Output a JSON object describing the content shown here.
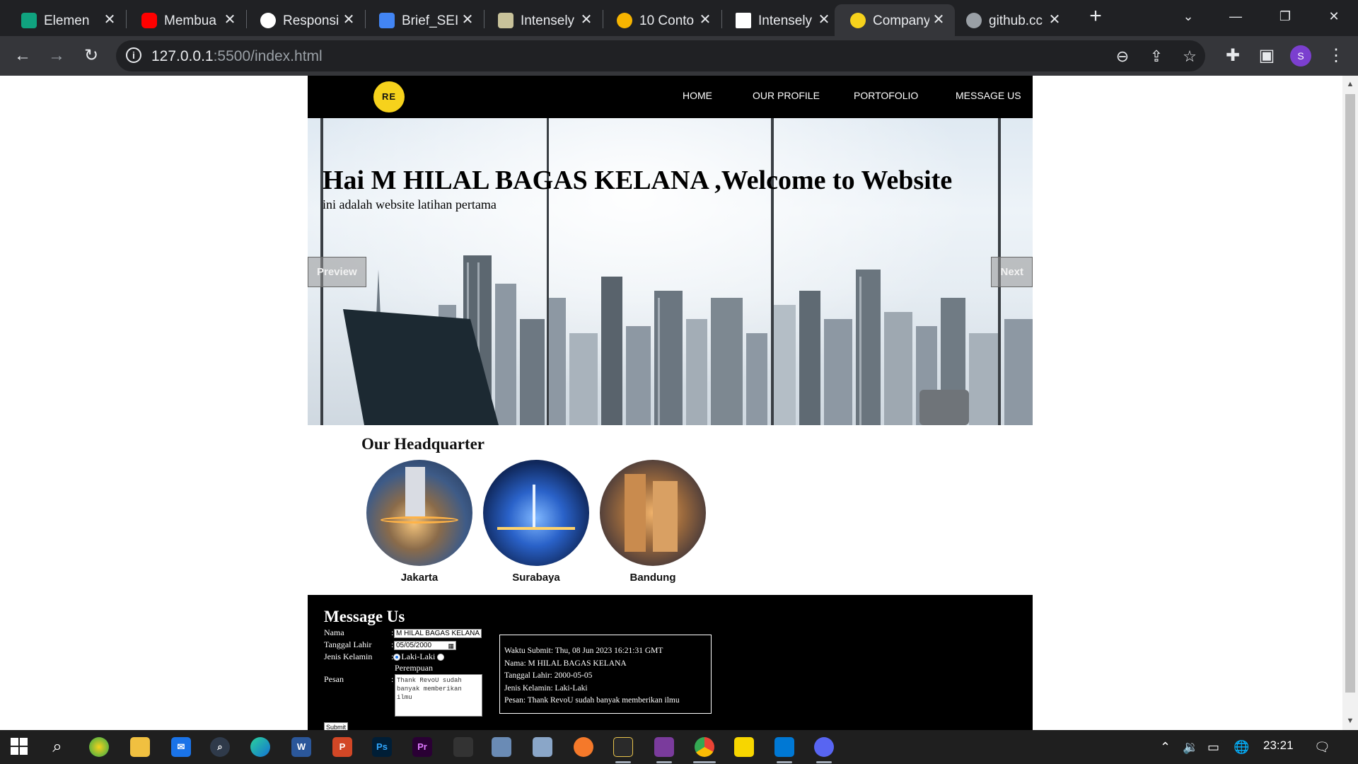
{
  "browser": {
    "tabs": [
      {
        "title": "Elemen",
        "icon": "chatgpt-icon",
        "color": "#10a37f"
      },
      {
        "title": "Membua",
        "icon": "youtube-icon",
        "color": "#ff0000"
      },
      {
        "title": "Responsi",
        "icon": "github-icon",
        "color": "#ffffff"
      },
      {
        "title": "Brief_SEI",
        "icon": "google-docs-icon",
        "color": "#4285f4"
      },
      {
        "title": "Intensely",
        "icon": "page-icon",
        "color": "#c8c29a"
      },
      {
        "title": "10 Conto",
        "icon": "tutorial-icon",
        "color": "#f6b400"
      },
      {
        "title": "Intensely",
        "icon": "ens-icon",
        "color": "#ffffff"
      },
      {
        "title": "Company",
        "icon": "company-logo-icon",
        "color": "#f6d21c",
        "active": true
      },
      {
        "title": "github.cc",
        "icon": "globe-icon",
        "color": "#9aa0a6"
      }
    ],
    "url_host": "127.0.0.1",
    "url_rest": ":5500/index.html",
    "profile_initial": "S"
  },
  "site": {
    "logo_text": "RE VO",
    "nav": [
      "HOME",
      "OUR PROFILE",
      "PORTOFOLIO",
      "MESSAGE US"
    ],
    "hero": {
      "title": "Hai M HILAL BAGAS KELANA ,Welcome to Website",
      "subtitle": "ini adalah website latihan pertama",
      "prev_label": "Preview",
      "next_label": "Next"
    },
    "headquarter": {
      "title": "Our Headquarter",
      "cities": [
        "Jakarta",
        "Surabaya",
        "Bandung"
      ]
    },
    "message": {
      "title": "Message Us",
      "labels": {
        "nama": "Nama",
        "tanggal": "Tanggal Lahir",
        "gender": "Jenis Kelamin",
        "pesan": "Pesan"
      },
      "colon": ":",
      "nama_value": "M HILAL BAGAS KELANA",
      "tanggal_value": "05/05/2000",
      "gender_male": "Laki-Laki",
      "gender_female": "Perempuan",
      "pesan_value": "Thank RevoU sudah banyak memberikan ilmu",
      "submit_label": "Submit",
      "result": {
        "waktu": "Waktu Submit: Thu, 08 Jun 2023 16:21:31 GMT",
        "nama": "Nama: M HILAL BAGAS KELANA",
        "tanggal": "Tanggal Lahir: 2000-05-05",
        "gender": "Jenis Kelamin: Laki-Laki",
        "pesan": "Pesan: Thank RevoU sudah banyak memberikan ilmu"
      }
    }
  },
  "taskbar": {
    "clock": "23:21",
    "apps": [
      "start-icon",
      "search-icon",
      "paint-icon",
      "file-explorer-icon",
      "mail-icon",
      "magnifier-icon",
      "edge-icon",
      "word-icon",
      "powerpoint-icon",
      "photoshop-icon",
      "premiere-icon",
      "app-icon",
      "network-icon",
      "network-icon",
      "blender-icon",
      "video-editor-icon",
      "winrar-icon",
      "chrome-icon",
      "sticky-notes-icon",
      "vscode-icon",
      "discord-icon"
    ],
    "labels": {
      "word": "W",
      "powerpoint": "P",
      "photoshop": "Ps",
      "premiere": "Pr"
    }
  }
}
